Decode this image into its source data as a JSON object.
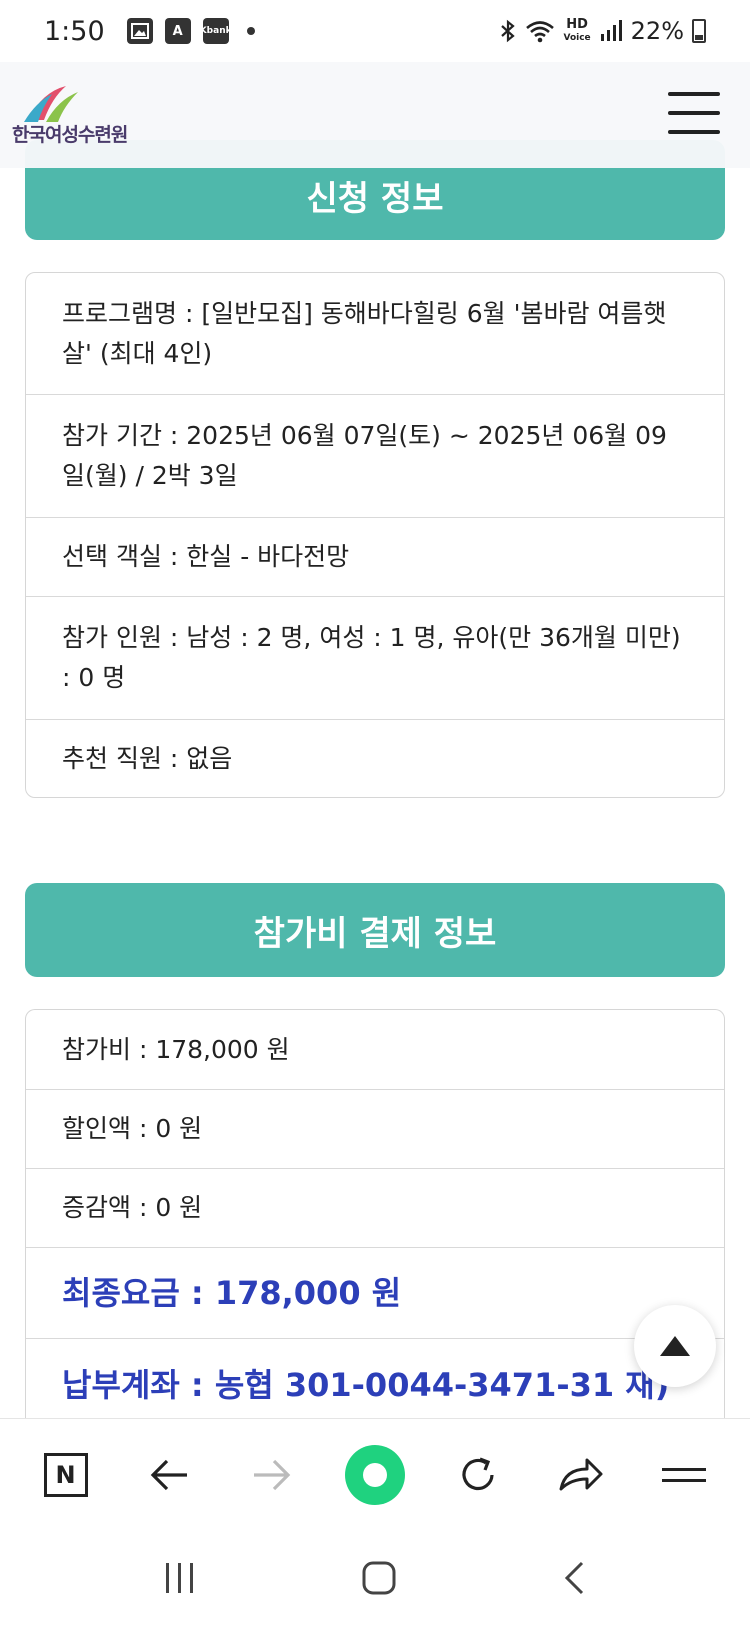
{
  "status_bar": {
    "time": "1:50",
    "icons": [
      "image-icon",
      "a-app-icon",
      "kbank-icon"
    ],
    "kbank_label": "Kbank",
    "a_label": "A",
    "hd_label": "HD",
    "voice_label": "Voice",
    "battery": "22%"
  },
  "header": {
    "logo_text": "한국여성수련원"
  },
  "application_section": {
    "title": "신청 정보",
    "rows": [
      "프로그램명 : [일반모집] 동해바다힐링 6월 '봄바람 여름햇살' (최대 4인)",
      "참가 기간 : 2025년 06월 07일(토) ~ 2025년 06월 09일(월) / 2박 3일",
      "선택 객실 : 한실 - 바다전망",
      "참가 인원 : 남성 : 2 명, 여성 : 1 명, 유아(만 36개월 미만) : 0 명",
      "추천 직원 : 없음"
    ]
  },
  "payment_section": {
    "title": "참가비 결제 정보",
    "rows": [
      "참가비 : 178,000 원",
      "할인액 : 0 원",
      "증감액 : 0 원"
    ],
    "final_fee": "최종요금 : 178,000 원",
    "account": "납부계좌 : 농협 301-0044-3471-31 재)"
  },
  "toolbar": {
    "n_label": "N"
  },
  "colors": {
    "section_header": "#4fb8ab",
    "highlight_text": "#2c3fb8",
    "green_button": "#1fd27f"
  }
}
